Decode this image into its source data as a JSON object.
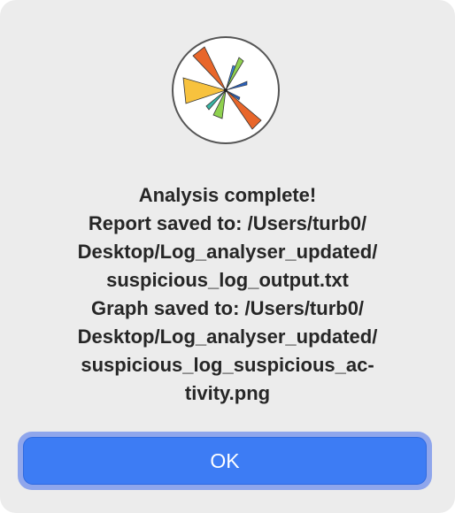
{
  "dialog": {
    "icon": "matplotlib-logo-icon",
    "message_lines": [
      "Analysis complete!",
      "Report saved to: /Users/turb0/",
      "Desktop/Log_analyser_updated/",
      "suspicious_log_output.txt",
      "Graph saved to: /Users/turb0/",
      "Desktop/Log_analyser_updated/",
      "suspicious_log_suspicious_ac-",
      "tivity.png"
    ],
    "ok_label": "OK"
  },
  "colors": {
    "dialog_background": "#ececec",
    "text": "#262626",
    "button_accent": "#3d7cf4",
    "focus_ring": "#8fa6ec"
  }
}
